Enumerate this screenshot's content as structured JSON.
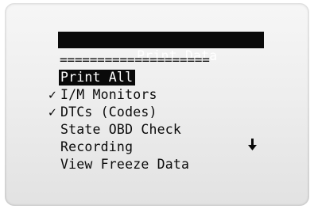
{
  "screen": {
    "title": "Print Data",
    "separator": "====================",
    "scroll_icon": "down-arrow-icon"
  },
  "menu": {
    "items": [
      {
        "label": "Print All",
        "checked": false,
        "selected": true,
        "check_mark": ""
      },
      {
        "label": "I/M Monitors",
        "checked": true,
        "selected": false,
        "check_mark": "✓"
      },
      {
        "label": "DTCs (Codes)",
        "checked": true,
        "selected": false,
        "check_mark": "✓"
      },
      {
        "label": "State OBD Check",
        "checked": false,
        "selected": false,
        "check_mark": ""
      },
      {
        "label": "Recording",
        "checked": false,
        "selected": false,
        "check_mark": ""
      },
      {
        "label": "View Freeze Data",
        "checked": false,
        "selected": false,
        "check_mark": ""
      }
    ]
  }
}
